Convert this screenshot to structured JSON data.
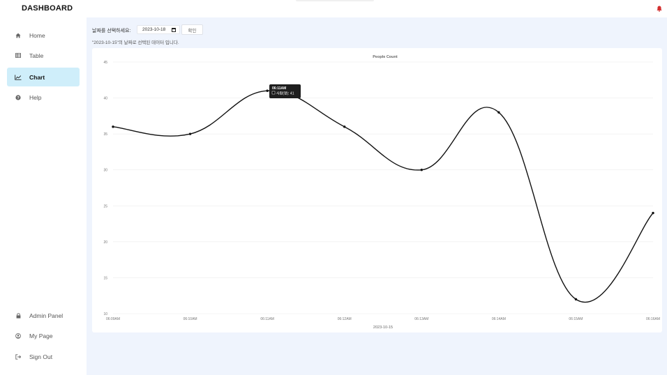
{
  "header": {
    "brand": "DASHBOARD",
    "bell_icon": "bell-icon",
    "bell_color": "#d32f2f"
  },
  "sidebar": {
    "items": [
      {
        "label": "Home",
        "icon": "home-icon",
        "active": false
      },
      {
        "label": "Table",
        "icon": "table-icon",
        "active": false
      },
      {
        "label": "Chart",
        "icon": "chart-line-icon",
        "active": true
      },
      {
        "label": "Help",
        "icon": "help-icon",
        "active": false
      }
    ],
    "bottom_items": [
      {
        "label": "Admin Panel",
        "icon": "lock-icon"
      },
      {
        "label": "My Page",
        "icon": "user-circle-icon"
      },
      {
        "label": "Sign Out",
        "icon": "sign-out-icon"
      }
    ]
  },
  "filter": {
    "label": "날짜를 선택하세요:",
    "date_value": "2023-10-18",
    "confirm_label": "확인",
    "info_text": "\"2023-10-15\"의 날짜로 선택된 데이터 입니다."
  },
  "colors": {
    "accent": "#cfeefa",
    "main_bg": "#eff4fd",
    "line": "#111111"
  },
  "tooltip": {
    "title": "06:11AM",
    "label": "사람(명): 41"
  },
  "chart_data": {
    "type": "line",
    "title": "People Count",
    "xlabel": "2023-10-15",
    "ylabel": "",
    "x": [
      "06:09AM",
      "06:10AM",
      "06:11AM",
      "06:12AM",
      "06:13AM",
      "06:14AM",
      "06:15AM",
      "06:16AM"
    ],
    "ylim": [
      10,
      45
    ],
    "yticks": [
      10,
      15,
      20,
      25,
      30,
      35,
      40,
      45
    ],
    "grid": true,
    "legend": "none",
    "series": [
      {
        "values": [
          36,
          35,
          41,
          36,
          30,
          38,
          12,
          24
        ]
      }
    ]
  }
}
